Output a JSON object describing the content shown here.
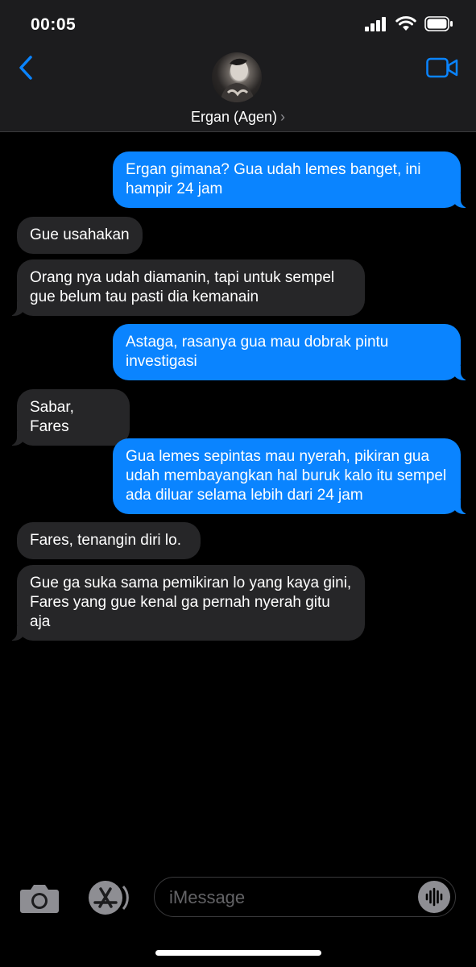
{
  "status": {
    "time": "00:05",
    "icons": [
      "cellular-signal-icon",
      "wifi-icon",
      "battery-icon"
    ]
  },
  "header": {
    "contact_name": "Ergan (Agen)",
    "chevron": "›",
    "icons": [
      "back-chevron-icon",
      "video-call-icon"
    ]
  },
  "messages": [
    {
      "from": "me",
      "text": "Ergan gimana? Gua udah lemes banget, ini hampir 24 jam"
    },
    {
      "from": "them",
      "text": "Gue usahakan"
    },
    {
      "from": "them",
      "text": "Orang nya udah diamanin, tapi untuk sempel gue belum tau pasti dia kemanain"
    },
    {
      "from": "me",
      "text": "Astaga, rasanya gua mau dobrak pintu investigasi"
    },
    {
      "from": "them",
      "text": "Sabar, Fares"
    },
    {
      "from": "me",
      "text": "Gua lemes sepintas mau nyerah, pikiran gua udah membayangkan hal buruk kalo itu sempel ada diluar selama lebih dari 24 jam"
    },
    {
      "from": "them",
      "text": "Fares, tenangin diri lo."
    },
    {
      "from": "them",
      "text": "Gue ga suka sama pemikiran lo yang kaya gini, Fares yang gue kenal ga pernah nyerah gitu aja"
    }
  ],
  "composer": {
    "placeholder": "iMessage",
    "icons": [
      "camera-icon",
      "app-store-icon",
      "audio-waveform-icon"
    ]
  },
  "colors": {
    "outgoing": "#0a84ff",
    "incoming": "#262628",
    "background": "#000000",
    "accent": "#0a84ff"
  }
}
